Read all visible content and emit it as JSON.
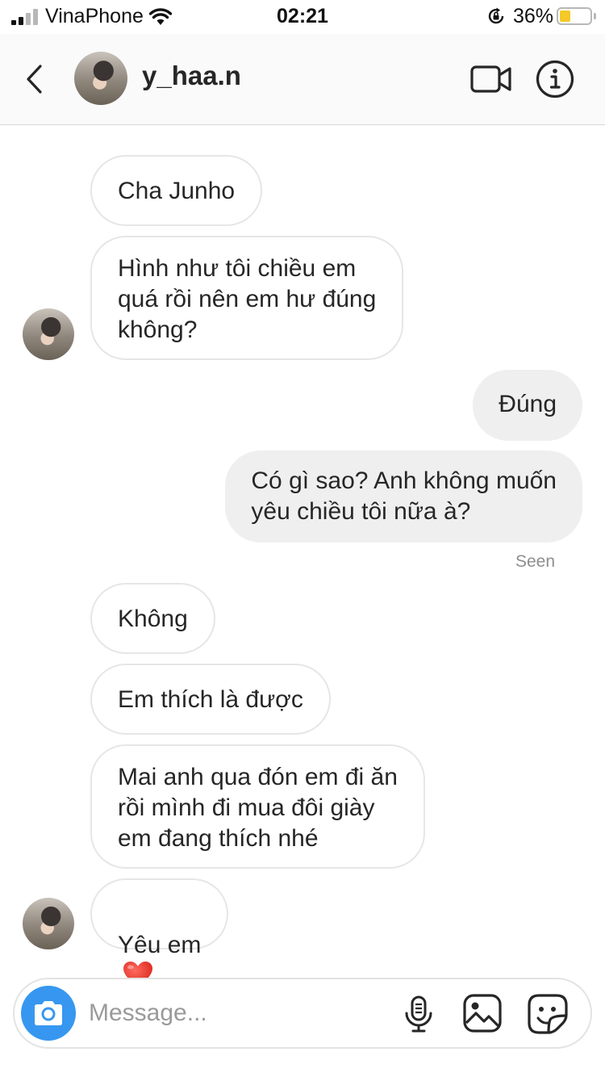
{
  "status_bar": {
    "carrier": "VinaPhone",
    "time": "02:21",
    "battery_percent": "36%",
    "battery_level": 0.36,
    "icons": [
      "signal-icon",
      "wifi-icon",
      "orientation-lock-icon",
      "battery-icon"
    ]
  },
  "header": {
    "username": "y_haa.n",
    "icons": [
      "back-chevron-icon",
      "avatar",
      "video-call-icon",
      "info-icon"
    ]
  },
  "messages": [
    {
      "id": "m1",
      "side": "incoming",
      "text": "Cha Junho"
    },
    {
      "id": "m2",
      "side": "incoming",
      "text": "Hình như tôi chiều em\nquá rồi nên em hư đúng\nkhông?"
    },
    {
      "id": "m3",
      "side": "outgoing",
      "text": "Đúng"
    },
    {
      "id": "m4",
      "side": "outgoing",
      "text": "Có gì sao? Anh không muốn\nyêu chiều tôi nữa à?"
    },
    {
      "id": "m5",
      "side": "incoming",
      "text": "Không"
    },
    {
      "id": "m6",
      "side": "incoming",
      "text": "Em thích là được"
    },
    {
      "id": "m7",
      "side": "incoming",
      "text": "Mai anh qua đón em đi ăn\nrồi mình đi mua đôi giày\nem đang thích nhé"
    },
    {
      "id": "m8",
      "side": "incoming",
      "text": "Yêu em",
      "emoji": "red-heart-icon"
    }
  ],
  "seen_label": "Seen",
  "composer": {
    "placeholder": "Message...",
    "icons": [
      "camera-icon",
      "microphone-icon",
      "gallery-icon",
      "sticker-icon"
    ]
  },
  "colors": {
    "accent_blue": "#3797f0",
    "outgoing_bubble": "#efefef",
    "incoming_border": "#e6e6e6",
    "battery_yellow": "#f5c928",
    "heart_red": "#e0352b"
  }
}
